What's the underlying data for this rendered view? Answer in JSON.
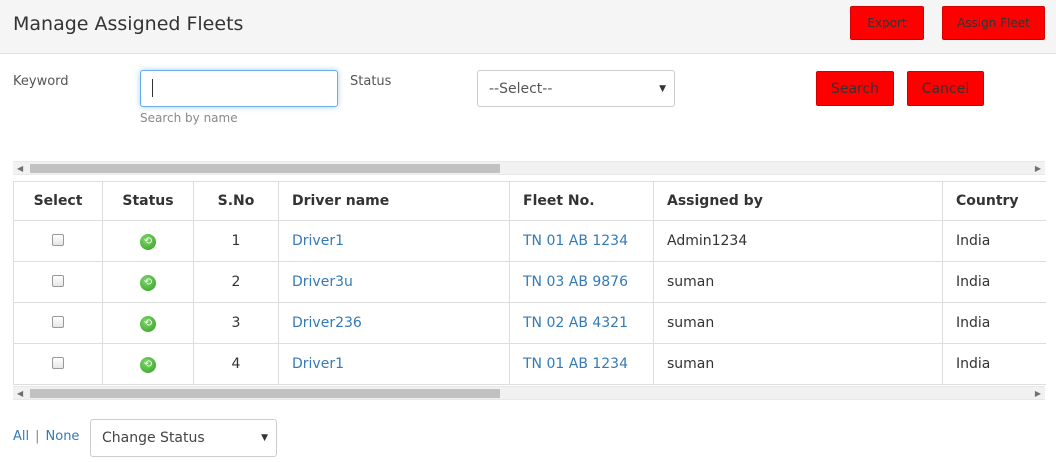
{
  "header": {
    "title": "Manage Assigned Fleets",
    "export_label": "Export",
    "assign_label": "Assign Fleet"
  },
  "filters": {
    "keyword_label": "Keyword",
    "keyword_value": "",
    "keyword_hint": "Search by name",
    "status_label": "Status",
    "status_selected": "--Select--",
    "search_label": "Search",
    "cancel_label": "Cancel"
  },
  "table": {
    "columns": [
      "Select",
      "Status",
      "S.No",
      "Driver name",
      "Fleet No.",
      "Assigned by",
      "Country"
    ],
    "rows": [
      {
        "sno": "1",
        "driver": "Driver1",
        "fleet": "TN 01 AB 1234",
        "assigned_by": "Admin1234",
        "country": "India"
      },
      {
        "sno": "2",
        "driver": "Driver3u",
        "fleet": "TN 03 AB 9876",
        "assigned_by": "suman",
        "country": "India"
      },
      {
        "sno": "3",
        "driver": "Driver236",
        "fleet": "TN 02 AB 4321",
        "assigned_by": "suman",
        "country": "India"
      },
      {
        "sno": "4",
        "driver": "Driver1",
        "fleet": "TN 01 AB 1234",
        "assigned_by": "suman",
        "country": "India"
      }
    ]
  },
  "footer": {
    "all_label": "All",
    "separator": "|",
    "none_label": "None",
    "change_status_selected": "Change Status"
  },
  "icons": {
    "status_icon": "green-back-arrow-icon",
    "select_arrow": "chevron-down-icon"
  },
  "colors": {
    "button_red": "#ff0000",
    "link_blue": "#337ab7",
    "status_green": "#3aa52d"
  }
}
